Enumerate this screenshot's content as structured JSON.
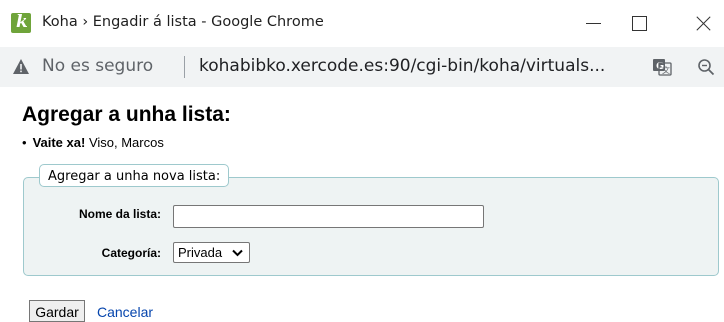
{
  "window": {
    "title": "Koha › Engadir á lista - Google Chrome",
    "icon": "koha-k-icon"
  },
  "address_bar": {
    "security_label": "No es seguro",
    "url": "kohabibko.xercode.es:90/cgi-bin/koha/virtuals..."
  },
  "page": {
    "title": "Agregar a unha lista:",
    "info_label": "Vaite xa!",
    "info_text": " Viso, Marcos",
    "fieldset_legend": "Agregar a unha nova lista:",
    "list_name_label": "Nome da lista:",
    "list_name_value": "",
    "category_label": "Categoría:",
    "category_selected": "Privada",
    "save_label": "Gardar",
    "cancel_label": "Cancelar"
  },
  "colors": {
    "accent_link": "#0645ad",
    "fieldset_border": "#9ec9cd",
    "fieldset_bg": "#eef3f3",
    "koha_icon": "#6fa43a"
  }
}
